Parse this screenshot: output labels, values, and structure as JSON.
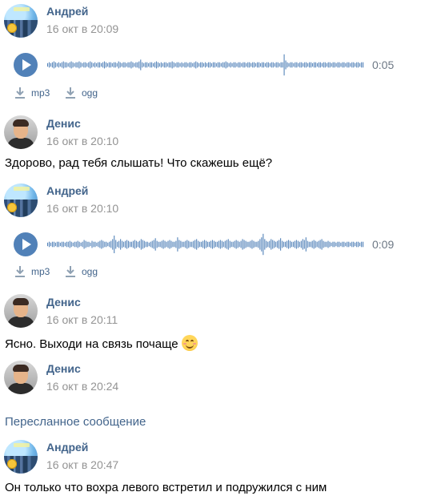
{
  "colors": {
    "accent": "#5181b8",
    "name": "#42648b",
    "time": "#939393",
    "wave": "#5181b8"
  },
  "messages": [
    {
      "author": "Андрей",
      "time": "16 окт в 20:09",
      "voice": {
        "duration": "0:05",
        "downloads": [
          "mp3",
          "ogg"
        ],
        "wave": [
          2,
          3,
          2,
          3,
          4,
          3,
          2,
          3,
          2,
          3,
          4,
          3,
          3,
          2,
          3,
          4,
          3,
          2,
          3,
          3,
          4,
          3,
          2,
          3,
          3,
          2,
          3,
          4,
          3,
          2,
          3,
          2,
          3,
          3,
          2,
          3,
          4,
          3,
          2,
          3,
          3,
          2,
          3,
          3,
          2,
          4,
          3,
          2,
          3,
          3,
          2,
          3,
          3,
          4,
          3,
          2,
          3,
          3,
          4,
          6,
          3,
          2,
          3,
          3,
          2,
          3,
          3,
          2,
          3,
          4,
          3,
          2,
          3,
          2,
          3,
          3,
          2,
          3,
          3,
          4,
          3,
          2,
          3,
          3,
          2,
          3,
          2,
          3,
          3,
          2,
          3,
          3,
          2,
          3,
          4,
          3,
          2,
          3,
          3,
          2,
          3,
          2,
          3,
          3,
          2,
          3,
          3,
          2,
          3,
          3,
          2,
          3,
          3,
          4,
          3,
          2,
          3,
          2,
          3,
          3,
          2,
          3,
          3,
          2,
          3,
          3,
          2,
          3,
          3,
          2,
          3,
          3,
          2,
          3,
          3,
          2,
          3,
          3,
          2,
          3,
          3,
          2,
          3,
          3,
          2,
          3,
          3,
          2,
          3,
          3,
          12,
          5,
          3,
          2,
          3,
          3,
          2,
          3,
          3,
          2,
          3,
          3,
          2,
          3,
          3,
          2,
          3,
          3,
          2,
          3,
          3,
          2,
          3,
          3,
          2,
          3,
          3,
          2,
          3,
          3,
          2,
          3,
          3,
          2,
          3,
          3,
          2,
          3,
          3,
          2,
          3,
          3,
          2,
          3,
          3,
          2,
          3,
          3,
          2,
          3,
          3
        ]
      }
    },
    {
      "author": "Денис",
      "time": "16 окт в 20:10",
      "text": "Здорово, рад тебя слышать! Что скажешь ещё?"
    },
    {
      "author": "Андрей",
      "time": "16 окт в 20:10",
      "voice": {
        "duration": "0:09",
        "downloads": [
          "mp3",
          "ogg"
        ],
        "wave": [
          2,
          3,
          2,
          3,
          3,
          2,
          3,
          3,
          2,
          3,
          3,
          2,
          3,
          3,
          4,
          3,
          2,
          3,
          3,
          4,
          3,
          2,
          3,
          5,
          4,
          3,
          3,
          2,
          4,
          3,
          3,
          2,
          3,
          4,
          5,
          4,
          3,
          3,
          2,
          3,
          4,
          6,
          10,
          5,
          3,
          4,
          6,
          4,
          3,
          4,
          5,
          4,
          3,
          3,
          4,
          5,
          4,
          3,
          4,
          6,
          5,
          4,
          3,
          3,
          2,
          3,
          4,
          5,
          7,
          4,
          3,
          3,
          4,
          5,
          4,
          3,
          4,
          5,
          4,
          3,
          3,
          4,
          8,
          5,
          4,
          3,
          3,
          4,
          5,
          4,
          3,
          3,
          4,
          5,
          6,
          4,
          3,
          3,
          4,
          5,
          4,
          3,
          3,
          4,
          5,
          4,
          3,
          3,
          4,
          5,
          4,
          3,
          4,
          5,
          6,
          4,
          3,
          3,
          4,
          5,
          4,
          3,
          4,
          6,
          5,
          4,
          3,
          3,
          4,
          5,
          4,
          3,
          3,
          4,
          6,
          8,
          12,
          6,
          4,
          3,
          4,
          6,
          5,
          4,
          3,
          4,
          5,
          7,
          4,
          3,
          3,
          4,
          5,
          4,
          3,
          3,
          4,
          5,
          4,
          3,
          4,
          6,
          5,
          8,
          4,
          3,
          3,
          4,
          5,
          4,
          3,
          4,
          5,
          6,
          4,
          3,
          3,
          4,
          3,
          2,
          3,
          3,
          2,
          3,
          3,
          2,
          3,
          3,
          2,
          3,
          3,
          2,
          3,
          3,
          2,
          3,
          3,
          2,
          3,
          3
        ]
      }
    },
    {
      "author": "Денис",
      "time": "16 окт в 20:11",
      "text": "Ясно. Выходи на связь почаще"
    },
    {
      "author": "Денис",
      "time": "16 окт в 20:24"
    },
    {
      "author": "Андрей",
      "time": "16 окт в 20:47",
      "text": "Он только что вохра левого встретил и подружился с ним"
    }
  ],
  "forwarded_label": "Пересланное сообщение"
}
